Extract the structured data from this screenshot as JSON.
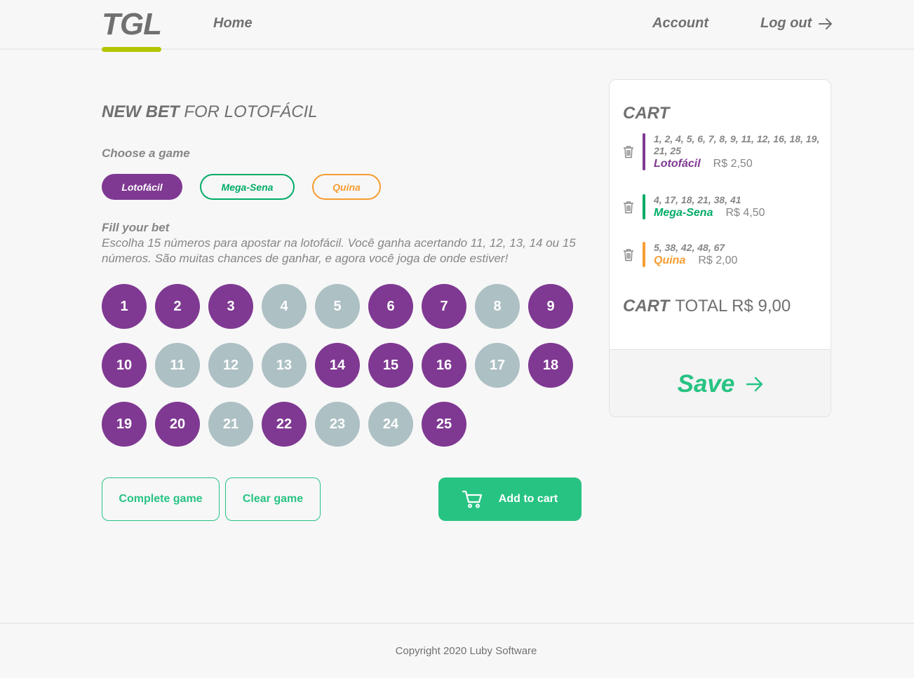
{
  "header": {
    "logo": "TGL",
    "nav": {
      "home": "Home",
      "account": "Account",
      "logout": "Log out"
    }
  },
  "bet": {
    "title_bold": "NEW BET",
    "title_rest": "FOR LOTOFÁCIL",
    "choose_label": "Choose a game",
    "games": [
      {
        "label": "Lotofácil",
        "color": "#7f3992",
        "selected": true
      },
      {
        "label": "Mega-Sena",
        "color": "#01ac66",
        "selected": false
      },
      {
        "label": "Quina",
        "color": "#f79c31",
        "selected": false
      }
    ],
    "fill_title": "Fill your bet",
    "fill_description": "Escolha 15 números para apostar na lotofácil. Você ganha acertando 11, 12, 13, 14 ou 15 números. São muitas chances de ganhar, e agora você joga de onde estiver!",
    "numbers": [
      "1",
      "2",
      "3",
      "4",
      "5",
      "6",
      "7",
      "8",
      "9",
      "10",
      "11",
      "12",
      "13",
      "14",
      "15",
      "16",
      "17",
      "18",
      "19",
      "20",
      "21",
      "22",
      "23",
      "24",
      "25"
    ],
    "selected_numbers": [
      "1",
      "2",
      "3",
      "6",
      "7",
      "9",
      "10",
      "14",
      "15",
      "16",
      "18",
      "19",
      "20",
      "22",
      "25"
    ],
    "selected_color": "#7f3992",
    "unselected_color": "#adc0c4",
    "actions": {
      "complete": "Complete game",
      "clear": "Clear game",
      "add": "Add to cart"
    }
  },
  "cart": {
    "title": "CART",
    "items": [
      {
        "numbers": "1, 2, 4, 5, 6, 7, 8, 9, 11, 12, 16, 18, 19, 21, 25",
        "game": "Lotofácil",
        "price": "R$ 2,50",
        "color": "#7f3992"
      },
      {
        "numbers": "4, 17, 18, 21, 38, 41",
        "game": "Mega-Sena",
        "price": "R$ 4,50",
        "color": "#01ac66"
      },
      {
        "numbers": "5, 38, 42, 48, 67",
        "game": "Quina",
        "price": "R$ 2,00",
        "color": "#f79c31"
      }
    ],
    "total_label": "CART",
    "total_text": "TOTAL R$ 9,00",
    "save": "Save"
  },
  "footer": {
    "copyright": "Copyright 2020 Luby Software"
  },
  "colors": {
    "accent": "#27c383",
    "logo_bar": "#b5c401"
  }
}
